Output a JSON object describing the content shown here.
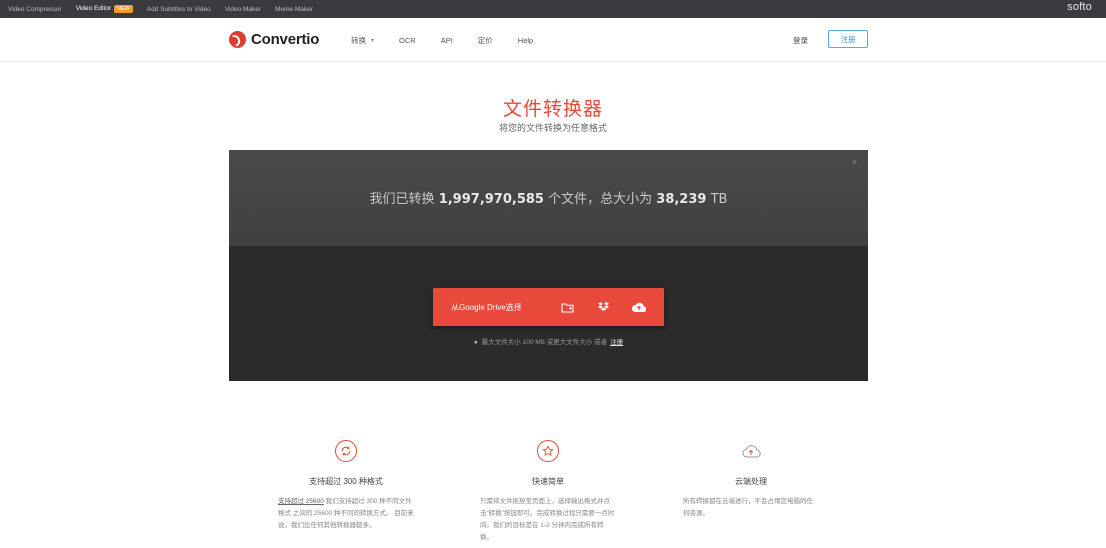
{
  "topbar": {
    "links": [
      {
        "label": "Video Compressor",
        "active": false
      },
      {
        "label": "Video Editor",
        "active": true,
        "badge": "NEW"
      },
      {
        "label": "Add Subtitles to Video",
        "active": false
      },
      {
        "label": "Video Maker",
        "active": false
      },
      {
        "label": "Meme Maker",
        "active": false
      }
    ],
    "brand": "softo"
  },
  "header": {
    "logo_text": "Convertio",
    "nav": [
      {
        "label": "转换",
        "has_caret": true
      },
      {
        "label": "OCR",
        "has_caret": false
      },
      {
        "label": "API",
        "has_caret": false
      },
      {
        "label": "定价",
        "has_caret": false
      },
      {
        "label": "Help",
        "has_caret": false
      }
    ],
    "login": "登录",
    "signup": "注册"
  },
  "hero": {
    "title": "文件转换器",
    "subtitle": "将您的文件转换为任意格式"
  },
  "converter": {
    "stats_prefix": "我们已转换",
    "files_count": "1,997,970,585",
    "stats_middle": "个文件，总大小为",
    "total_size": "38,239",
    "size_unit": "TB",
    "close_icon": "×",
    "upload_label": "从Google Drive选择",
    "upload_icons": [
      "folder-icon",
      "dropbox-icon",
      "google-drive-icon"
    ],
    "hint_text": "最大文件大小 100 MB 或更大文件大小 或者",
    "hint_link": "注册"
  },
  "features": [
    {
      "icon": "refresh-icon",
      "title": "支持超过 300 种格式",
      "desc_link": "支持超过 25600",
      "desc": "我们支持超过 300 种不同文件格式 之间的 25600 种不同的转换方式。 目前来说，我们比任何其他转换器都多。"
    },
    {
      "icon": "star-icon",
      "title": "快速简单",
      "desc": "只需将文件拖放至页面上，选择输出格式并点击“转换”按钮即可。完成转换过程只需要一点时间。我们的目标是在 1-2 分钟内完成所有转换。"
    },
    {
      "icon": "cloud-icon",
      "title": "云端处理",
      "desc": "所有转换都在云端进行，不会占用您电脑的任何资源。"
    }
  ],
  "colors": {
    "accent": "#e8493b",
    "panel_dark": "#2b2b2b",
    "topbar": "#3a3b3f",
    "signup_border": "#59a6e8"
  }
}
